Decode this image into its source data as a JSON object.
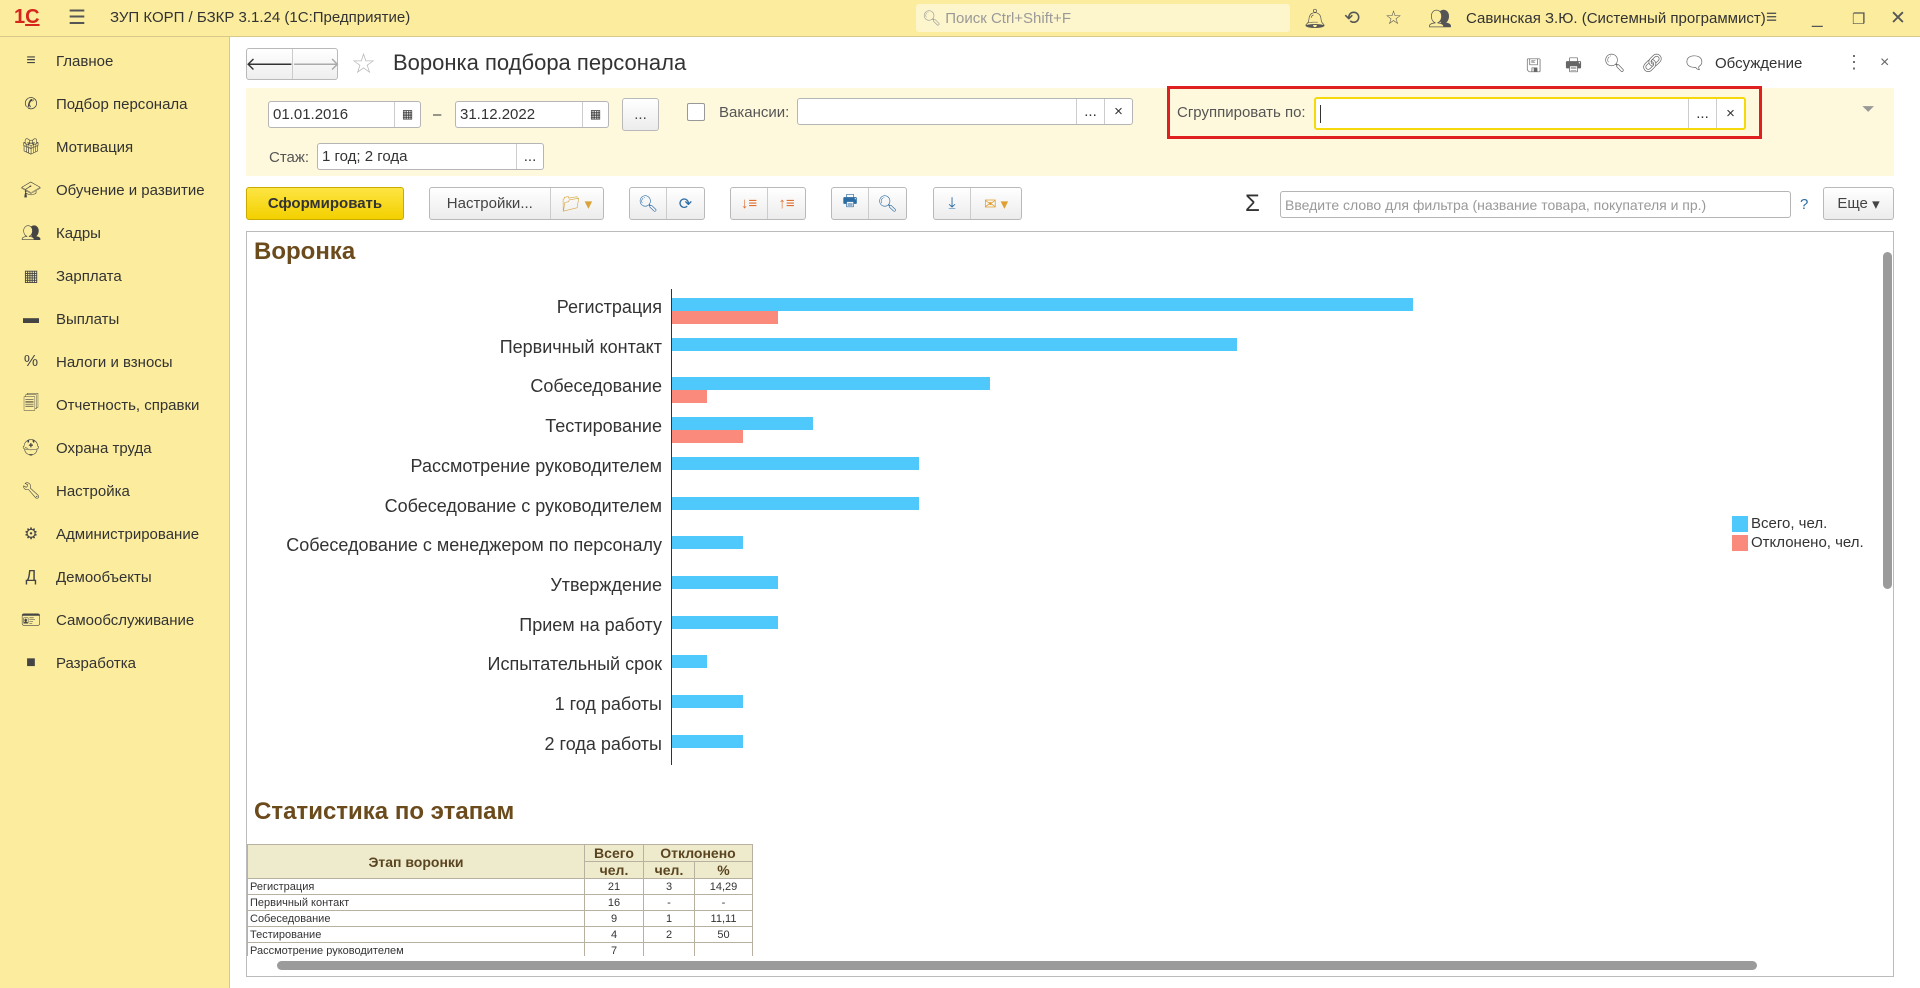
{
  "app": {
    "title": "ЗУП КОРП / БЗКР 3.1.24  (1С:Предприятие)",
    "search_placeholder": "Поиск Ctrl+Shift+F",
    "user": "Савинская З.Ю. (Системный программист)"
  },
  "sidebar": {
    "items": [
      {
        "label": "Главное",
        "icon": "menu-icon"
      },
      {
        "label": "Подбор персонала",
        "icon": "phone-icon"
      },
      {
        "label": "Мотивация",
        "icon": "gift-icon"
      },
      {
        "label": "Обучение и развитие",
        "icon": "graduation-icon"
      },
      {
        "label": "Кадры",
        "icon": "people-icon"
      },
      {
        "label": "Зарплата",
        "icon": "calculator-icon"
      },
      {
        "label": "Выплаты",
        "icon": "card-icon"
      },
      {
        "label": "Налоги и взносы",
        "icon": "percent-icon"
      },
      {
        "label": "Отчетность, справки",
        "icon": "reports-icon"
      },
      {
        "label": "Охрана труда",
        "icon": "helmet-icon"
      },
      {
        "label": "Настройка",
        "icon": "wrench-icon"
      },
      {
        "label": "Администрирование",
        "icon": "gear-icon"
      },
      {
        "label": "Демообъекты",
        "icon": "demo-icon"
      },
      {
        "label": "Самообслуживание",
        "icon": "id-card-icon"
      },
      {
        "label": "Разработка",
        "icon": "square-icon"
      }
    ]
  },
  "form": {
    "title": "Воронка подбора персонала",
    "discussion": "Обсуждение"
  },
  "filters": {
    "date_from": "01.01.2016",
    "date_to": "31.12.2022",
    "dash": "–",
    "dots": "...",
    "clear": "×",
    "vacancies_label": "Вакансии:",
    "vacancies_value": "",
    "group_label": "Сгруппировать по:",
    "group_value": "",
    "stazh_label": "Стаж:",
    "stazh_value": "1 год; 2 года"
  },
  "toolbar": {
    "generate": "Сформировать",
    "settings": "Настройки...",
    "filter_placeholder": "Введите слово для фильтра (название товара, покупателя и пр.)",
    "help": "?",
    "more": "Еще",
    "sigma": "Σ"
  },
  "colors": {
    "total": "#4fc8fb",
    "rejected": "#fa8a7c",
    "highlight": "#e02020",
    "accent": "#f5d90a"
  },
  "report": {
    "chart_title": "Воронка",
    "stats_title": "Статистика по этапам"
  },
  "chart_data": {
    "type": "bar",
    "orientation": "horizontal",
    "legend_position": "right",
    "categories": [
      "Регистрация",
      "Первичный контакт",
      "Собеседование",
      "Тестирование",
      "Рассмотрение руководителем",
      "Собеседование с руководителем",
      "Собеседование с менеджером по персоналу",
      "Утверждение",
      "Прием на работу",
      "Испытательный срок",
      "1 год работы",
      "2 года работы"
    ],
    "series": [
      {
        "name": "Всего, чел.",
        "values": [
          21,
          16,
          9,
          4,
          7,
          7,
          2,
          3,
          3,
          1,
          2,
          2
        ]
      },
      {
        "name": "Отклонено, чел.",
        "values": [
          3,
          0,
          1,
          2,
          0,
          0,
          0,
          0,
          0,
          0,
          0,
          0
        ]
      }
    ]
  },
  "table": {
    "headers": {
      "stage": "Этап воронки",
      "total": "Всего",
      "total_unit": "чел.",
      "rejected": "Отклонено",
      "rej_unit": "чел.",
      "rej_pct": "%"
    },
    "rows": [
      [
        "Регистрация",
        "21",
        "3",
        "14,29"
      ],
      [
        "Первичный контакт",
        "16",
        "-",
        "-"
      ],
      [
        "Собеседование",
        "9",
        "1",
        "11,11"
      ],
      [
        "Тестирование",
        "4",
        "2",
        "50"
      ],
      [
        "Рассмотрение руководителем",
        "7",
        "",
        ""
      ]
    ]
  }
}
